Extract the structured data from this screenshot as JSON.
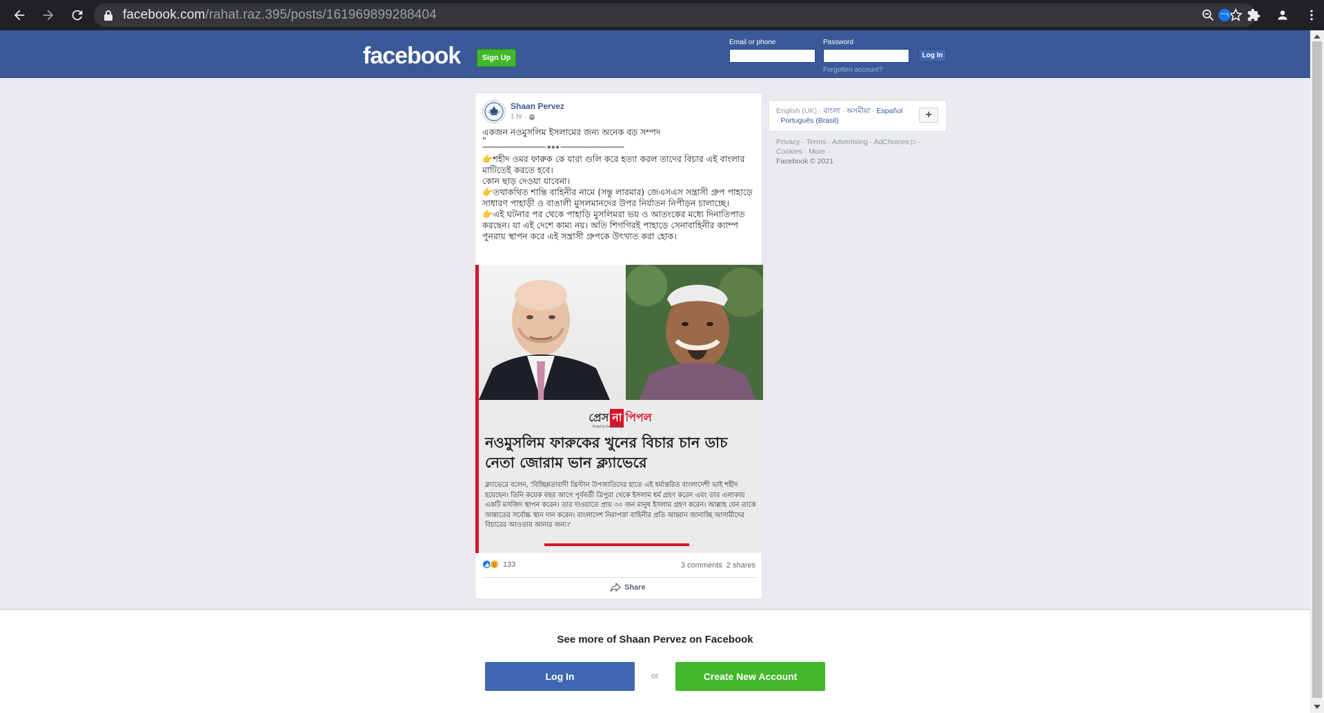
{
  "browser": {
    "url_host": "facebook.com",
    "url_path": "/rahat.raz.395/posts/161969899288404"
  },
  "header": {
    "logo": "facebook",
    "signup_label": "Sign Up",
    "email_label": "Email or phone",
    "password_label": "Password",
    "login_label": "Log In",
    "forgot_label": "Forgotten account?"
  },
  "post": {
    "author": "Shaan Pervez",
    "time": "1 hr ·",
    "title_line": "একজন নওমুসলিম ইসলামের জন্য অনেক বড় সম্পদ",
    "quote_mark": "\"",
    "separator": "┅┅┅┅┅┅┅┅┅┅┅┅┅┅┅┅┅┅┅┅┅┅┅┅ ★★★ ┅┅┅┅┅┅┅┅┅┅┅┅┅┅┅┅┅┅┅┅┅┅┅┅",
    "para1": "👉শহীদ ওমর ফারুক কে যারা গুলি করে হত্যা করল তাদের বিচার এই বাংলার মাটিতেই করতে হবে।",
    "para1b": "কোন ছাড় দেওয়া যাবেনা।",
    "para2": "👉তথাকথিত শান্তি বাহিনীর নামে (সন্তু লারমার) জেএসএস সন্ত্রাসী গ্রুপ পাহাড়ে সাধারণ পাহাড়ী ও বাঙালী মুসলমানদের উপর নির্যাতন নিপীড়ন চালাচ্ছে।",
    "para3": "👉এই ঘটনার পর থেকে পাহাড়ি মুসলিমরা ভয় ও আতংকের মধ্যে দিনাতিপাত করছেন। যা এই দেশে কাম্য নয়। অতি শিগগিরই পাহাড়ে সেনাবাহিনীর ক্যাম্প পুনরায় স্থাপন করে এই সন্ত্রাসী গ্রুপকে উৎখাত করা হোক।",
    "image": {
      "brand_a": "প্রেস",
      "brand_b": "না",
      "brand_c": "পিপল",
      "brand_sub": "Road to Democracy",
      "headline": "নওমুসলিম ফারুকের খুনের বিচার চান ডাচ নেতা জোরাম ভান ক্ল্যাভেরে",
      "body": "ক্ল্যাভেরে বলেন, 'বিচ্ছিন্নতাবাদী খ্রিস্টান উপজাতিদের হাতে এই ধর্মান্তরিত বাংলাদেশী ভাই শহীদ হয়েছেন। তিনি কয়েক বছর আগে পূর্ববর্তী ত্রিপুরা থেকে ইসলাম ধর্ম গ্রহণ করেন এবং তার এলাকায় একটি মসজিদ স্থাপন করেন। তার দাওয়াতে প্রায় ৩০ জন মানুষ ইসলাম গ্রহণ করেন। আল্লাহ যেন তাকে জান্নাতের সর্বোচ্চ স্থান দান করেন। বাংলাদেশ নিরাপত্তা বাহিনীর প্রতি আহ্বান জানাচ্ছি আসামীদের বিচারের আওতায় আনার জন্য।'"
    },
    "reaction_count": "133",
    "comments": "3 comments",
    "shares": "2 shares",
    "share_label": "Share"
  },
  "sidebar": {
    "current_language": "English (UK)",
    "languages": [
      "বাংলা",
      "অসমীয়া",
      "Español",
      "Português (Brasil)"
    ],
    "plus_label": "+",
    "footer_line1": "Privacy · Terms · Advertising · AdChoices ▷ ·",
    "footer_line2": "Cookies · More ·",
    "copyright": "Facebook © 2021"
  },
  "bottom": {
    "see_more": "See more of Shaan Pervez on Facebook",
    "login_label": "Log In",
    "or_label": "or",
    "create_label": "Create New Account"
  },
  "colors": {
    "fb_blue": "#3b5998",
    "green": "#42b72a",
    "link": "#385898"
  }
}
